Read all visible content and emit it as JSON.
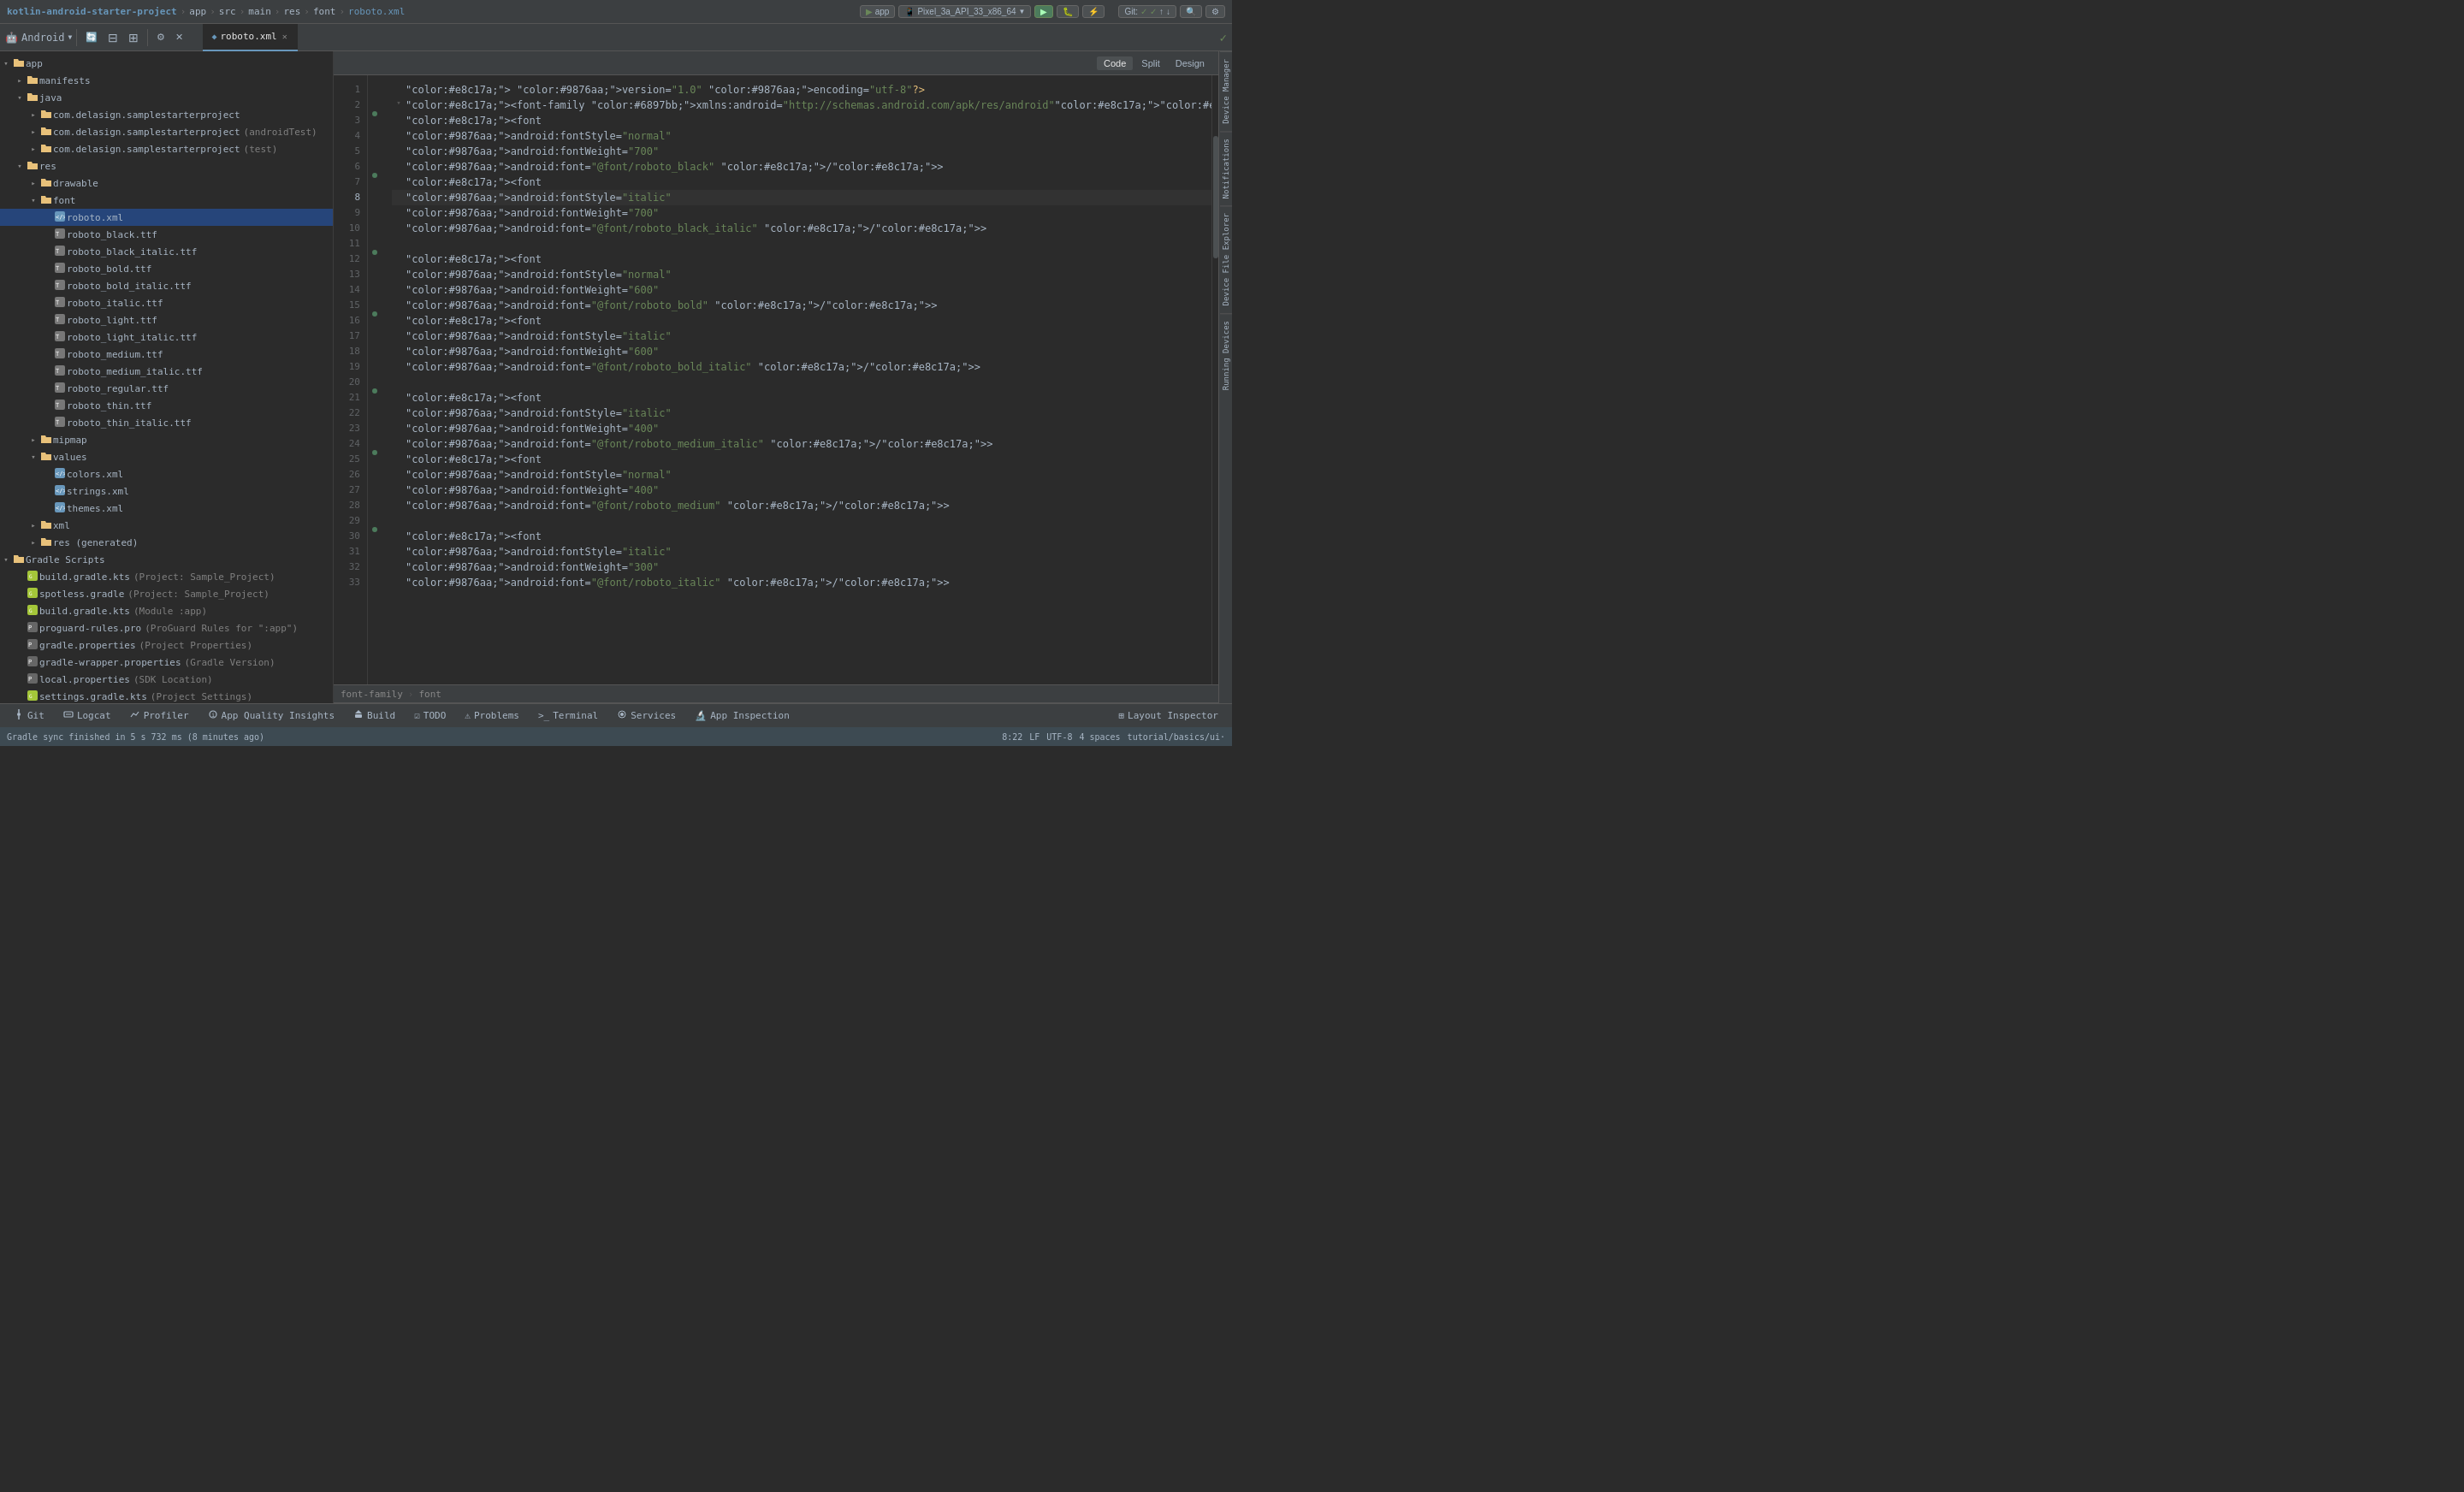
{
  "titlebar": {
    "breadcrumbs": [
      "kotlin-android-starter-project",
      "app",
      "src",
      "main",
      "res",
      "font",
      "roboto.xml"
    ],
    "run_config": "app",
    "device": "Pixel_3a_API_33_x86_64"
  },
  "toolbar": {
    "android_label": "Android",
    "sync_icon": "⟳",
    "structure_icon": "≡",
    "build_icon": "🔨",
    "settings_icon": "⚙",
    "close_icon": "✕"
  },
  "editor_tab": {
    "label": "roboto.xml",
    "is_active": true
  },
  "view_buttons": [
    {
      "label": "Code",
      "active": true
    },
    {
      "label": "Split",
      "active": false
    },
    {
      "label": "Design",
      "active": false
    }
  ],
  "sidebar": {
    "title": "Android",
    "tree": [
      {
        "id": "app",
        "level": 0,
        "label": "app",
        "type": "folder-open",
        "expanded": true
      },
      {
        "id": "manifests",
        "level": 1,
        "label": "manifests",
        "type": "folder",
        "expanded": false
      },
      {
        "id": "java",
        "level": 1,
        "label": "java",
        "type": "folder-open",
        "expanded": true
      },
      {
        "id": "com1",
        "level": 2,
        "label": "com.delasign.samplestarterproject",
        "type": "folder",
        "expanded": false
      },
      {
        "id": "com2",
        "level": 2,
        "label": "com.delasign.samplestarterproject",
        "secondary": "(androidTest)",
        "type": "folder",
        "expanded": false
      },
      {
        "id": "com3",
        "level": 2,
        "label": "com.delasign.samplestarterproject",
        "secondary": "(test)",
        "type": "folder",
        "expanded": false
      },
      {
        "id": "res",
        "level": 1,
        "label": "res",
        "type": "folder-open",
        "expanded": true
      },
      {
        "id": "drawable",
        "level": 2,
        "label": "drawable",
        "type": "folder",
        "expanded": false
      },
      {
        "id": "font",
        "level": 2,
        "label": "font",
        "type": "folder-open",
        "expanded": true,
        "selected": false
      },
      {
        "id": "roboto_xml",
        "level": 3,
        "label": "roboto.xml",
        "type": "xml",
        "selected": true
      },
      {
        "id": "roboto_black_ttf",
        "level": 3,
        "label": "roboto_black.ttf",
        "type": "ttf"
      },
      {
        "id": "roboto_black_italic_ttf",
        "level": 3,
        "label": "roboto_black_italic.ttf",
        "type": "ttf"
      },
      {
        "id": "roboto_bold_ttf",
        "level": 3,
        "label": "roboto_bold.ttf",
        "type": "ttf"
      },
      {
        "id": "roboto_bold_italic_ttf",
        "level": 3,
        "label": "roboto_bold_italic.ttf",
        "type": "ttf"
      },
      {
        "id": "roboto_italic_ttf",
        "level": 3,
        "label": "roboto_italic.ttf",
        "type": "ttf"
      },
      {
        "id": "roboto_light_ttf",
        "level": 3,
        "label": "roboto_light.ttf",
        "type": "ttf"
      },
      {
        "id": "roboto_light_italic_ttf",
        "level": 3,
        "label": "roboto_light_italic.ttf",
        "type": "ttf"
      },
      {
        "id": "roboto_medium_ttf",
        "level": 3,
        "label": "roboto_medium.ttf",
        "type": "ttf"
      },
      {
        "id": "roboto_medium_italic_ttf",
        "level": 3,
        "label": "roboto_medium_italic.ttf",
        "type": "ttf"
      },
      {
        "id": "roboto_regular_ttf",
        "level": 3,
        "label": "roboto_regular.ttf",
        "type": "ttf"
      },
      {
        "id": "roboto_thin_ttf",
        "level": 3,
        "label": "roboto_thin.ttf",
        "type": "ttf"
      },
      {
        "id": "roboto_thin_italic_ttf",
        "level": 3,
        "label": "roboto_thin_italic.ttf",
        "type": "ttf"
      },
      {
        "id": "mipmap",
        "level": 2,
        "label": "mipmap",
        "type": "folder",
        "expanded": false
      },
      {
        "id": "values",
        "level": 2,
        "label": "values",
        "type": "folder-open",
        "expanded": true
      },
      {
        "id": "colors_xml",
        "level": 3,
        "label": "colors.xml",
        "type": "xml"
      },
      {
        "id": "strings_xml",
        "level": 3,
        "label": "strings.xml",
        "type": "xml"
      },
      {
        "id": "themes_xml",
        "level": 3,
        "label": "themes.xml",
        "type": "xml"
      },
      {
        "id": "xml2",
        "level": 2,
        "label": "xml",
        "type": "folder",
        "expanded": false
      },
      {
        "id": "res_generated",
        "level": 2,
        "label": "res (generated)",
        "type": "folder",
        "expanded": false
      },
      {
        "id": "gradle_scripts",
        "level": 0,
        "label": "Gradle Scripts",
        "type": "folder-open",
        "expanded": true
      },
      {
        "id": "build_gradle_1",
        "level": 1,
        "label": "build.gradle.kts",
        "secondary": "(Project: Sample_Project)",
        "type": "gradle"
      },
      {
        "id": "spotless_gradle",
        "level": 1,
        "label": "spotless.gradle",
        "secondary": "(Project: Sample_Project)",
        "type": "gradle"
      },
      {
        "id": "build_gradle_2",
        "level": 1,
        "label": "build.gradle.kts",
        "secondary": "(Module :app)",
        "type": "gradle"
      },
      {
        "id": "proguard",
        "level": 1,
        "label": "proguard-rules.pro",
        "secondary": "(ProGuard Rules for \":app\")",
        "type": "pro"
      },
      {
        "id": "gradle_properties",
        "level": 1,
        "label": "gradle.properties",
        "secondary": "(Project Properties)",
        "type": "properties"
      },
      {
        "id": "gradle_wrapper_properties",
        "level": 1,
        "label": "gradle-wrapper.properties",
        "secondary": "(Gradle Version)",
        "type": "properties"
      },
      {
        "id": "local_properties",
        "level": 1,
        "label": "local.properties",
        "secondary": "(SDK Location)",
        "type": "properties"
      },
      {
        "id": "settings_gradle",
        "level": 1,
        "label": "settings.gradle.kts",
        "secondary": "(Project Settings)",
        "type": "gradle"
      }
    ]
  },
  "code_lines": [
    {
      "num": 1,
      "has_fold": false,
      "has_gutter": false,
      "content": "<?xml version=\"1.0\" encoding=\"utf-8\"?>"
    },
    {
      "num": 2,
      "has_fold": true,
      "has_gutter": false,
      "content": "<font-family xmlns:android=\"http://schemas.android.com/apk/res/android\">"
    },
    {
      "num": 3,
      "has_fold": false,
      "has_gutter": true,
      "content": "    <font"
    },
    {
      "num": 4,
      "has_fold": false,
      "has_gutter": false,
      "content": "        android:fontStyle=\"normal\""
    },
    {
      "num": 5,
      "has_fold": false,
      "has_gutter": false,
      "content": "        android:fontWeight=\"700\""
    },
    {
      "num": 6,
      "has_fold": false,
      "has_gutter": false,
      "content": "        android:font=\"@font/roboto_black\" />"
    },
    {
      "num": 7,
      "has_fold": false,
      "has_gutter": true,
      "content": "    <font"
    },
    {
      "num": 8,
      "has_fold": false,
      "has_gutter": false,
      "content": "        android:fontStyle=\"italic\"",
      "current": true
    },
    {
      "num": 9,
      "has_fold": false,
      "has_gutter": false,
      "content": "        android:fontWeight=\"700\""
    },
    {
      "num": 10,
      "has_fold": false,
      "has_gutter": false,
      "content": "        android:font=\"@font/roboto_black_italic\" />"
    },
    {
      "num": 11,
      "has_fold": false,
      "has_gutter": false,
      "content": ""
    },
    {
      "num": 12,
      "has_fold": false,
      "has_gutter": true,
      "content": "    <font"
    },
    {
      "num": 13,
      "has_fold": false,
      "has_gutter": false,
      "content": "        android:fontStyle=\"normal\""
    },
    {
      "num": 14,
      "has_fold": false,
      "has_gutter": false,
      "content": "        android:fontWeight=\"600\""
    },
    {
      "num": 15,
      "has_fold": false,
      "has_gutter": false,
      "content": "        android:font=\"@font/roboto_bold\" />"
    },
    {
      "num": 16,
      "has_fold": false,
      "has_gutter": true,
      "content": "    <font"
    },
    {
      "num": 17,
      "has_fold": false,
      "has_gutter": false,
      "content": "        android:fontStyle=\"italic\""
    },
    {
      "num": 18,
      "has_fold": false,
      "has_gutter": false,
      "content": "        android:fontWeight=\"600\""
    },
    {
      "num": 19,
      "has_fold": false,
      "has_gutter": false,
      "content": "        android:font=\"@font/roboto_bold_italic\" />"
    },
    {
      "num": 20,
      "has_fold": false,
      "has_gutter": false,
      "content": ""
    },
    {
      "num": 21,
      "has_fold": false,
      "has_gutter": true,
      "content": "    <font"
    },
    {
      "num": 22,
      "has_fold": false,
      "has_gutter": false,
      "content": "        android:fontStyle=\"italic\""
    },
    {
      "num": 23,
      "has_fold": false,
      "has_gutter": false,
      "content": "        android:fontWeight=\"400\""
    },
    {
      "num": 24,
      "has_fold": false,
      "has_gutter": false,
      "content": "        android:font=\"@font/roboto_medium_italic\" />"
    },
    {
      "num": 25,
      "has_fold": false,
      "has_gutter": true,
      "content": "    <font"
    },
    {
      "num": 26,
      "has_fold": false,
      "has_gutter": false,
      "content": "        android:fontStyle=\"normal\""
    },
    {
      "num": 27,
      "has_fold": false,
      "has_gutter": false,
      "content": "        android:fontWeight=\"400\""
    },
    {
      "num": 28,
      "has_fold": false,
      "has_gutter": false,
      "content": "        android:font=\"@font/roboto_medium\" />"
    },
    {
      "num": 29,
      "has_fold": false,
      "has_gutter": false,
      "content": ""
    },
    {
      "num": 30,
      "has_fold": false,
      "has_gutter": true,
      "content": "    <font"
    },
    {
      "num": 31,
      "has_fold": false,
      "has_gutter": false,
      "content": "        android:fontStyle=\"italic\""
    },
    {
      "num": 32,
      "has_fold": false,
      "has_gutter": false,
      "content": "        android:fontWeight=\"300\""
    },
    {
      "num": 33,
      "has_fold": false,
      "has_gutter": false,
      "content": "        android:font=\"@font/roboto_italic\" />"
    }
  ],
  "breadcrumb_bottom": [
    "font-family",
    "font"
  ],
  "status_bar": {
    "git_branch": "Git",
    "logcat": "Logcat",
    "profiler": "Profiler",
    "app_quality": "App Quality Insights",
    "build": "Build",
    "todo": "TODO",
    "problems": "Problems",
    "terminal": "Terminal",
    "services": "Services",
    "app_inspection": "App Inspection",
    "layout_inspector": "Layout Inspector",
    "position": "8:22",
    "line_ending": "LF",
    "encoding": "UTF-8",
    "indent": "4 spaces",
    "location": "tutorial/basics/ui·",
    "sync_message": "Gradle sync finished in 5 s 732 ms (8 minutes ago)"
  },
  "right_tabs": [
    "Device Manager",
    "Notifications",
    "Device File Explorer",
    "Running Devices"
  ],
  "colors": {
    "accent": "#6897bb",
    "bg_dark": "#2b2b2b",
    "bg_medium": "#3c3f41",
    "selected": "#26457a",
    "string": "#6a8759",
    "keyword": "#e8c17a",
    "attr": "#9876aa",
    "check_ok": "#6a8759"
  }
}
